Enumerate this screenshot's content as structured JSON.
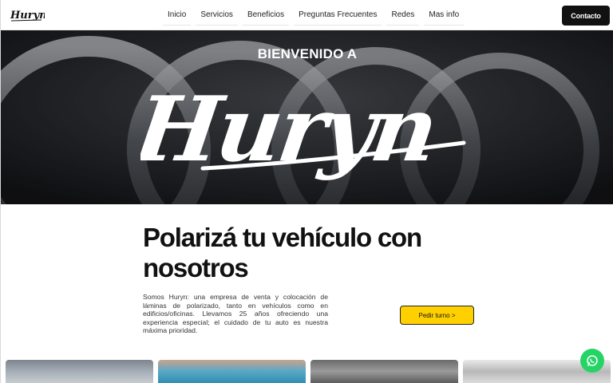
{
  "brand": {
    "name": "Huryn"
  },
  "nav": {
    "items": [
      {
        "label": "Inicio"
      },
      {
        "label": "Servicios"
      },
      {
        "label": "Beneficios"
      },
      {
        "label": "Preguntas Frecuentes"
      },
      {
        "label": "Redes"
      },
      {
        "label": "Mas info"
      }
    ],
    "contact_label": "Contacto"
  },
  "hero": {
    "welcome": "BIENVENIDO A",
    "logo_text": "Huryn"
  },
  "intro": {
    "headline": "Polarizá tu vehículo con nosotros",
    "description": "Somos Huryn: una empresa de venta y colocación de láminas de polarizado, tanto en vehículos como en edificios/oficinas. Llevamos 25 años ofreciendo una experiencia especial; el cuidado de tu auto es nuestra máxima prioridad.",
    "cta_label": "Pedir turno >"
  },
  "colors": {
    "accent": "#ffd000",
    "dark": "#111111",
    "whatsapp": "#25d366"
  },
  "icons": {
    "floating": "whatsapp-icon"
  }
}
